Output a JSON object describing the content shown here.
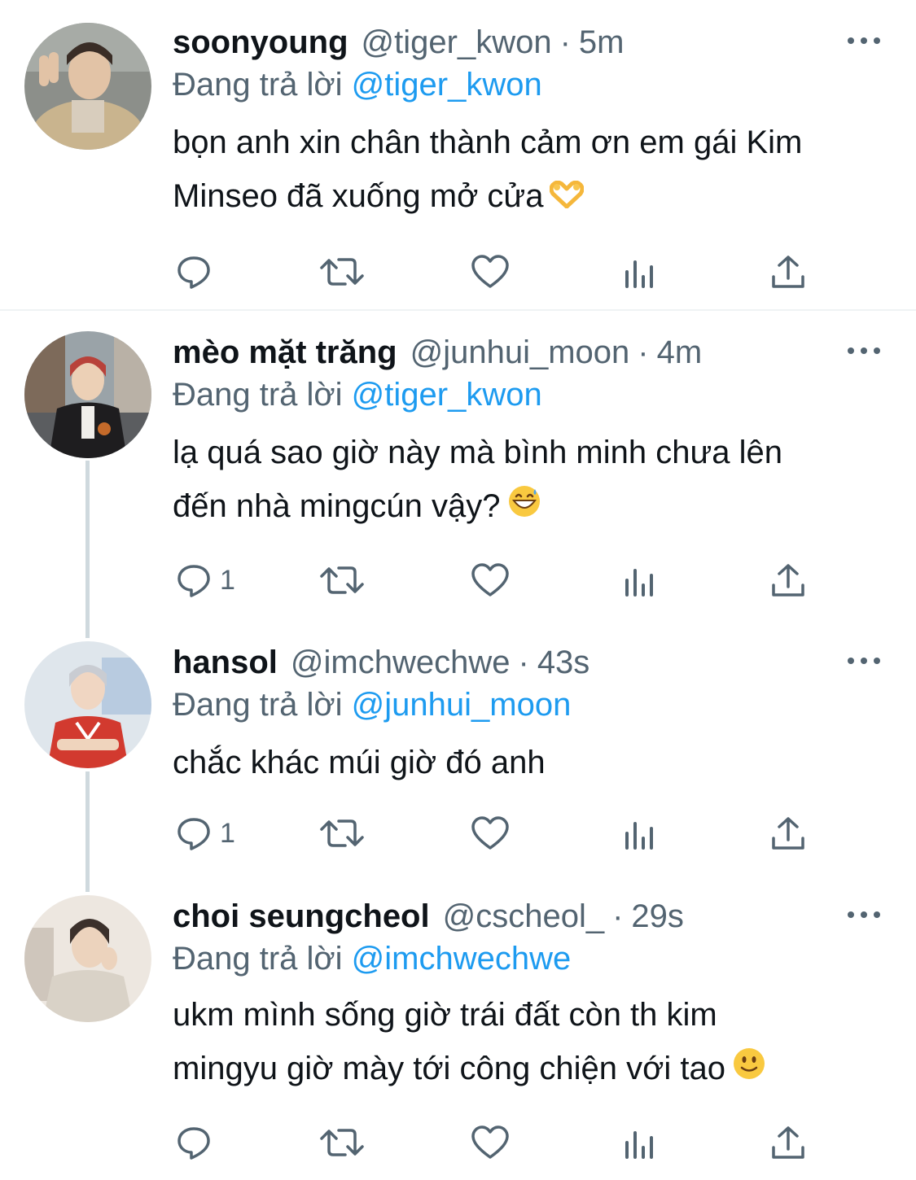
{
  "tweets": [
    {
      "name": "soonyoung",
      "handle": "@tiger_kwon",
      "dot": "·",
      "time": "5m",
      "reply_prefix": "Đang trả lời",
      "reply_to": "@tiger_kwon",
      "text_line1": "bọn anh xin chân thành cảm ơn em gái Kim",
      "text_line2": "Minseo đã xuống mở cửa",
      "emoji": "heart-hands-emoji",
      "reply_count": ""
    },
    {
      "name": "mèo mặt trăng",
      "handle": "@junhui_moon",
      "dot": "·",
      "time": "4m",
      "reply_prefix": "Đang trả lời",
      "reply_to": "@tiger_kwon",
      "text_line1": "lạ quá sao giờ này mà bình minh chưa lên",
      "text_line2": "đến nhà mingcún vậy?",
      "emoji": "grinning-sweat-emoji",
      "reply_count": "1"
    },
    {
      "name": "hansol",
      "handle": "@imchwechwe",
      "dot": "·",
      "time": "43s",
      "reply_prefix": "Đang trả lời",
      "reply_to": "@junhui_moon",
      "text_line1": "chắc khác múi giờ đó anh",
      "text_line2": "",
      "emoji": "",
      "reply_count": "1"
    },
    {
      "name": "choi seungcheol",
      "handle": "@cscheol_",
      "dot": "·",
      "time": "29s",
      "reply_prefix": "Đang trả lời",
      "reply_to": "@imchwechwe",
      "text_line1": "ukm mình sống giờ trái đất còn th kim",
      "text_line2": "mingyu giờ mày tới công chiện với tao",
      "emoji": "slightly-smiling-emoji",
      "reply_count": ""
    }
  ],
  "icons": {
    "reply": "reply-icon",
    "retweet": "retweet-icon",
    "like": "like-icon",
    "views": "views-icon",
    "share": "share-icon",
    "more": "more-icon"
  },
  "colors": {
    "text": "#0f1419",
    "secondary": "#536471",
    "link": "#1d9bf0",
    "thread_line": "#cfd9de",
    "divider": "#eff3f4"
  }
}
